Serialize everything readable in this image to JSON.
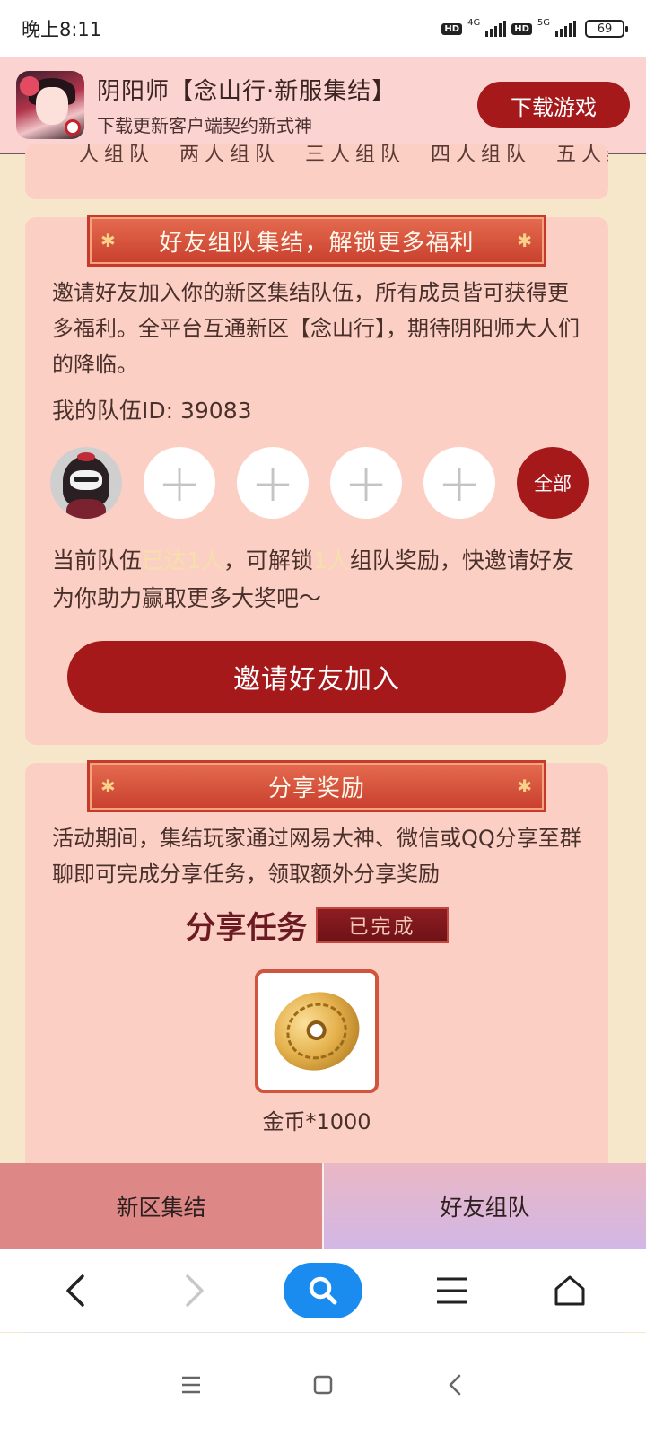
{
  "status_bar": {
    "time": "晚上8:11",
    "hd1": "HD",
    "net1": "4G",
    "hd2": "HD",
    "net2": "5G",
    "battery": "69"
  },
  "app_banner": {
    "title": "阴阳师【念山行·新服集结】",
    "subtitle": "下载更新客户端契约新式神",
    "download_label": "下载游戏"
  },
  "top_card_cut_text": "人组队　两人组队　三人组队　四人组队　五人组队",
  "team_section": {
    "ribbon_title": "好友组队集结，解锁更多福利",
    "description": "邀请好友加入你的新区集结队伍，所有成员皆可获得更多福利。全平台互通新区【念山行】，期待阴阳师大人们的降临。",
    "team_id": "我的队伍ID: 39083",
    "slot_plus": "+",
    "all_label": "全部",
    "status_prefix": "当前队伍",
    "status_reached": "已达1人",
    "status_mid": "，可解锁",
    "status_count": "1人",
    "status_suffix": "组队奖励，快邀请好友为你助力赢取更多大奖吧～",
    "invite_label": "邀请好友加入"
  },
  "share_section": {
    "ribbon_title": "分享奖励",
    "description": "活动期间，集结玩家通过网易大神、微信或QQ分享至群聊即可完成分享任务，领取额外分享奖励",
    "task_title": "分享任务",
    "task_status": "已完成",
    "reward_label": "金币*1000"
  },
  "bottom_tabs": [
    {
      "label": "新区集结"
    },
    {
      "label": "好友组队"
    }
  ],
  "colors": {
    "accent_red": "#a5191b",
    "card_bg": "#fccfc4",
    "page_bg": "#f6e7cb",
    "search_blue": "#1a8cf0"
  }
}
